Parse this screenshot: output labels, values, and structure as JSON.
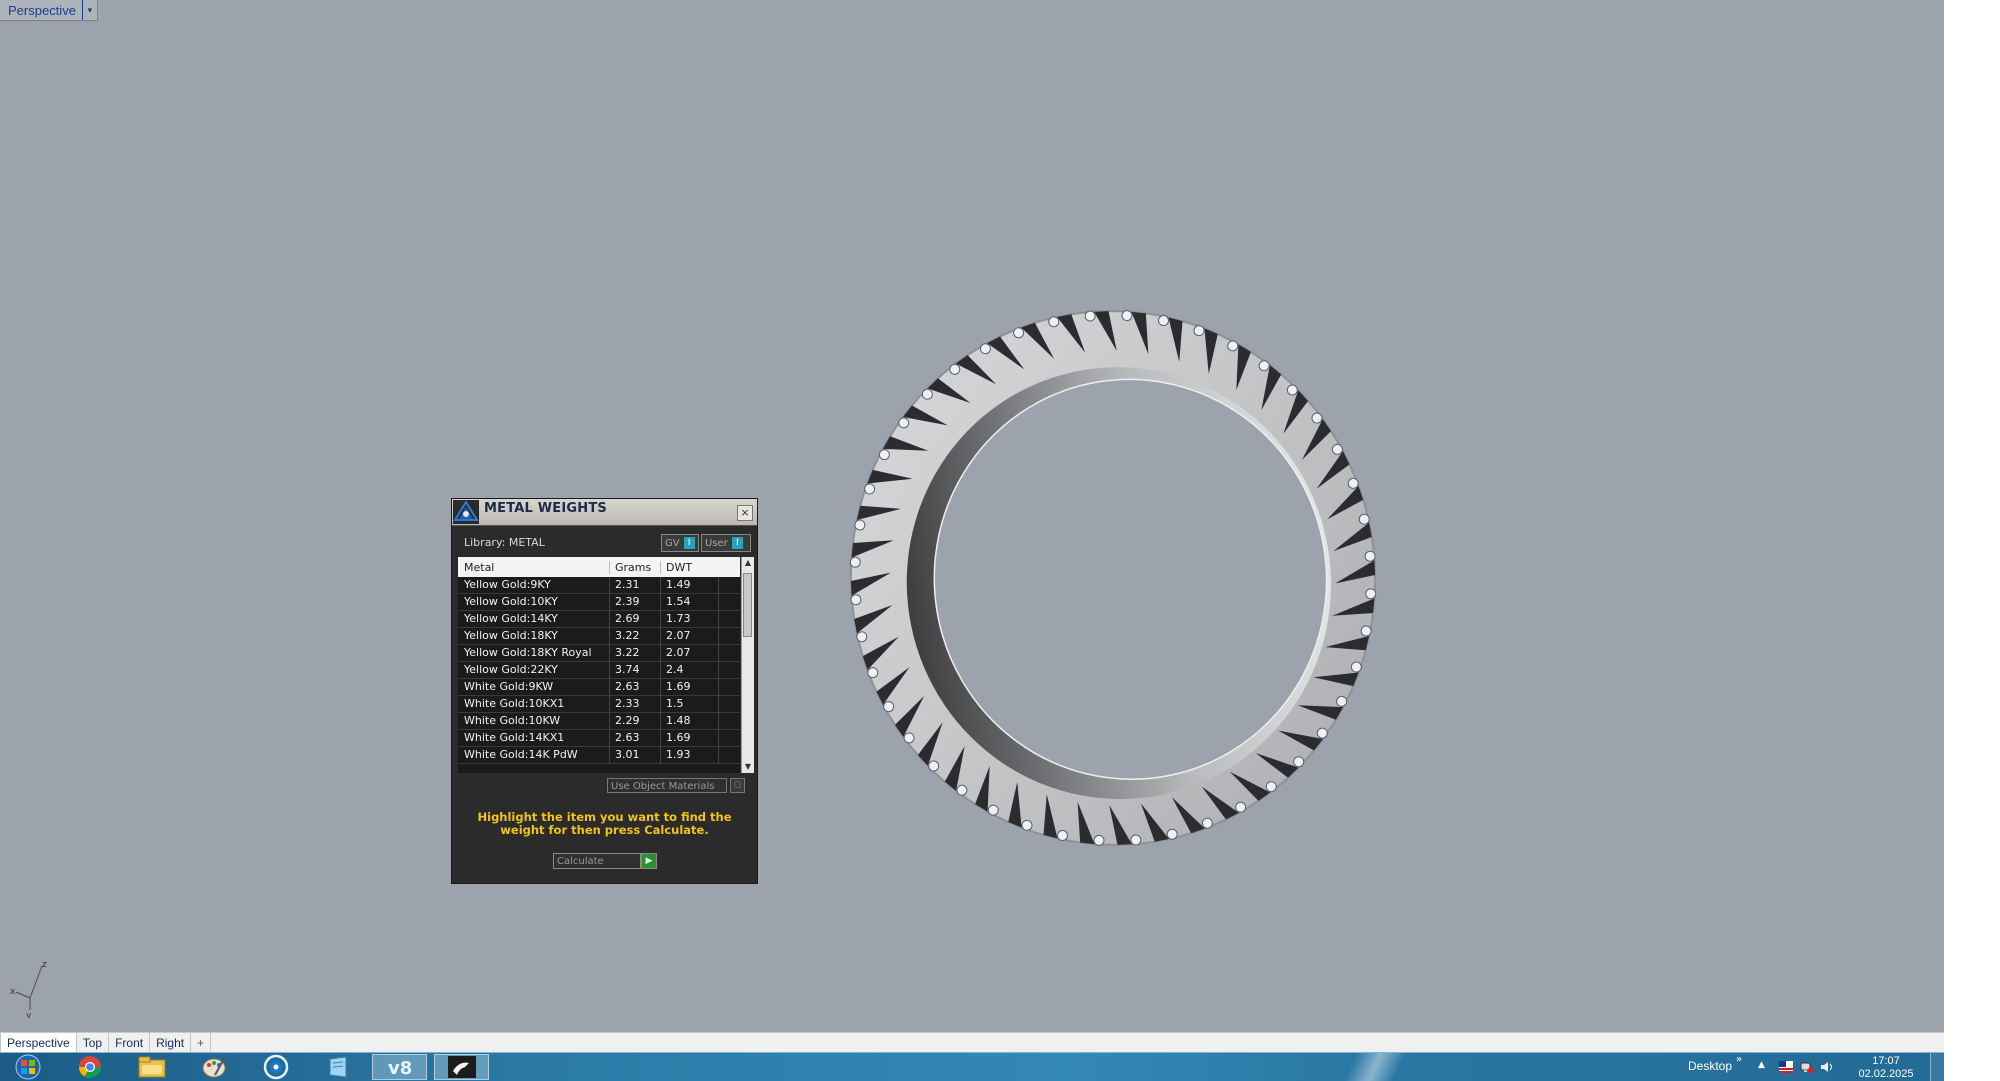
{
  "viewport": {
    "title": "Perspective",
    "dropdown_arrow": "▾",
    "background": "#9da3ac",
    "axis": {
      "z": "z",
      "x": "x",
      "y": "y"
    }
  },
  "dialog": {
    "title": "METAL WEIGHTS",
    "close": "×",
    "library_label": "Library: METAL",
    "toggle_gv": "GV",
    "toggle_user": "User",
    "columns": [
      "Metal",
      "Grams",
      "DWT"
    ],
    "rows": [
      [
        "Yellow Gold:9KY",
        "2.31",
        "1.49"
      ],
      [
        "Yellow Gold:10KY",
        "2.39",
        "1.54"
      ],
      [
        "Yellow Gold:14KY",
        "2.69",
        "1.73"
      ],
      [
        "Yellow Gold:18KY",
        "3.22",
        "2.07"
      ],
      [
        "Yellow Gold:18KY Royal",
        "3.22",
        "2.07"
      ],
      [
        "Yellow Gold:22KY",
        "3.74",
        "2.4"
      ],
      [
        "White Gold:9KW",
        "2.63",
        "1.69"
      ],
      [
        "White Gold:10KX1",
        "2.33",
        "1.5"
      ],
      [
        "White Gold:10KW",
        "2.29",
        "1.48"
      ],
      [
        "White Gold:14KX1",
        "2.63",
        "1.69"
      ],
      [
        "White Gold:14K PdW",
        "3.01",
        "1.93"
      ]
    ],
    "use_object_materials": "Use Object Materials",
    "hint": "Highlight the item you want to find the weight for then press Calculate.",
    "calculate": "Calculate",
    "accent": "#f2c414"
  },
  "viewport_tabs": [
    "Perspective",
    "Top",
    "Front",
    "Right",
    "+"
  ],
  "taskbar": {
    "icons": [
      "start-orb",
      "chrome-icon",
      "file-explorer-icon",
      "paint-icon",
      "app-icon",
      "notepad-icon",
      "rhino-v8-icon",
      "matrix-icon"
    ],
    "desktop_label": "Desktop",
    "chevron": "»",
    "time": "17:07",
    "date": "02.02.2025"
  }
}
